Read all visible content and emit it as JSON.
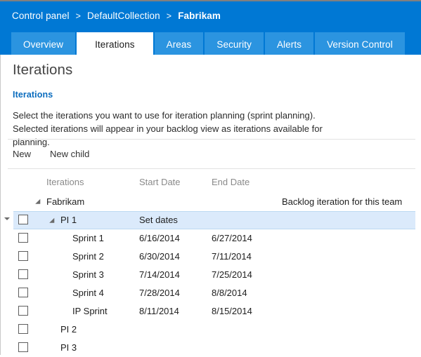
{
  "header": {
    "breadcrumb": [
      {
        "label": "Control panel",
        "current": false
      },
      {
        "label": "DefaultCollection",
        "current": false
      },
      {
        "label": "Fabrikam",
        "current": true
      }
    ],
    "separator": ">",
    "tabs": [
      {
        "label": "Overview",
        "active": false
      },
      {
        "label": "Iterations",
        "active": true
      },
      {
        "label": "Areas",
        "active": false
      },
      {
        "label": "Security",
        "active": false
      },
      {
        "label": "Alerts",
        "active": false
      },
      {
        "label": "Version Control",
        "active": false
      }
    ]
  },
  "page": {
    "title": "Iterations",
    "section_link": "Iterations",
    "description": "Select the iterations you want to use for iteration planning (sprint planning). Selected iterations will appear in your backlog view as iterations available for planning."
  },
  "toolbar": {
    "new_label": "New",
    "new_child_label": "New child"
  },
  "grid": {
    "columns": {
      "name": "Iterations",
      "start": "Start Date",
      "end": "End Date"
    },
    "rows": [
      {
        "name": "Fabrikam",
        "level": 0,
        "checkbox": false,
        "caret": true,
        "selected": false,
        "start": "",
        "end": "",
        "note": "Backlog iteration for this team"
      },
      {
        "name": "PI 1",
        "level": 1,
        "checkbox": true,
        "caret": true,
        "selected": true,
        "start": "Set dates",
        "start_is_link": true,
        "end": "",
        "note": ""
      },
      {
        "name": "Sprint 1",
        "level": 2,
        "checkbox": true,
        "caret": false,
        "selected": false,
        "start": "6/16/2014",
        "end": "6/27/2014",
        "note": ""
      },
      {
        "name": "Sprint 2",
        "level": 2,
        "checkbox": true,
        "caret": false,
        "selected": false,
        "start": "6/30/2014",
        "end": "7/11/2014",
        "note": ""
      },
      {
        "name": "Sprint 3",
        "level": 2,
        "checkbox": true,
        "caret": false,
        "selected": false,
        "start": "7/14/2014",
        "end": "7/25/2014",
        "note": ""
      },
      {
        "name": "Sprint 4",
        "level": 2,
        "checkbox": true,
        "caret": false,
        "selected": false,
        "start": "7/28/2014",
        "end": "8/8/2014",
        "note": ""
      },
      {
        "name": "IP Sprint",
        "level": 2,
        "checkbox": true,
        "caret": false,
        "selected": false,
        "start": "8/11/2014",
        "end": "8/15/2014",
        "note": ""
      },
      {
        "name": "PI 2",
        "level": 1,
        "checkbox": true,
        "caret": false,
        "selected": false,
        "start": "",
        "end": "",
        "note": ""
      },
      {
        "name": "PI 3",
        "level": 1,
        "checkbox": true,
        "caret": false,
        "selected": false,
        "start": "",
        "end": "",
        "note": ""
      }
    ]
  },
  "colors": {
    "header_blue": "#0078d4",
    "tab_blue": "#2b94e0",
    "link_blue": "#0a6cbe",
    "selected_row": "#dbeafb"
  }
}
